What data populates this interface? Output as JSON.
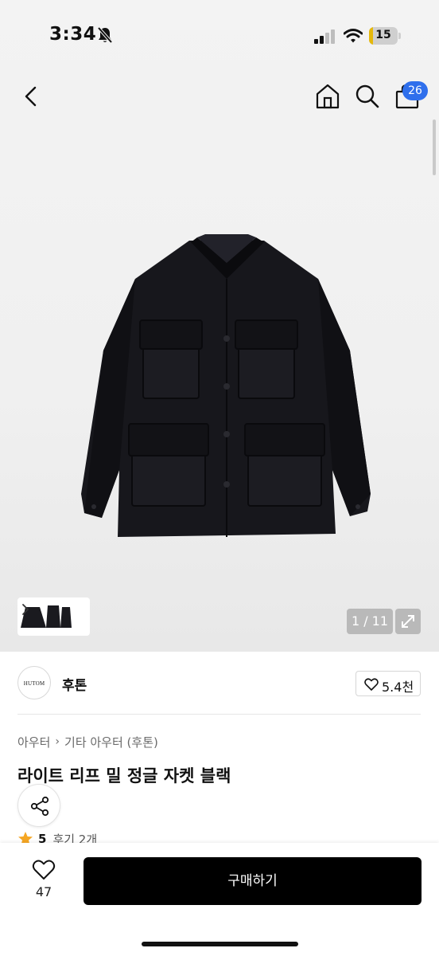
{
  "status_bar": {
    "time": "3:34",
    "battery_level": "15",
    "battery_fraction": 0.15,
    "icons": [
      "bell-slash-icon",
      "cellular-signal-icon",
      "wifi-icon",
      "battery-icon"
    ]
  },
  "nav": {
    "icons": [
      "back-chevron-icon",
      "home-icon",
      "search-icon",
      "shopping-bag-icon"
    ],
    "cart_count": "26"
  },
  "gallery": {
    "image_alt": "black jacket product photo",
    "counter": "1 / 11",
    "expand_icon": "expand-arrows-icon"
  },
  "store": {
    "logo_text": "HUTOM",
    "name": "후톤",
    "like_count": "5.4천"
  },
  "breadcrumb": {
    "level1": "아우터",
    "level2": "기타 아우터 (후톤)"
  },
  "product": {
    "title": "라이트 리프 밀 정글 자켓 블랙",
    "rating": "5",
    "reviews": "후기 2개",
    "rating_color": "#f5a623"
  },
  "bottom_bar": {
    "wish_count": "47",
    "buy_label": "구매하기",
    "buy_color": "#000000",
    "badge_color": "#2f6fec"
  }
}
